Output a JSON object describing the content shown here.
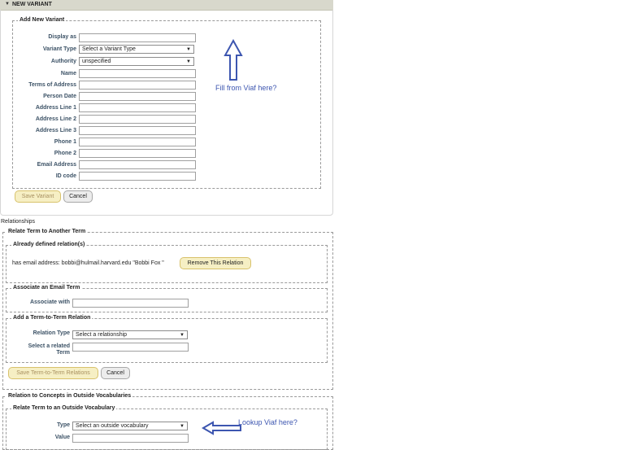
{
  "header": {
    "title": "NEW VARIANT"
  },
  "new_variant": {
    "legend": "Add New Variant",
    "fields": {
      "display_as": {
        "label": "Display as",
        "value": ""
      },
      "variant_type": {
        "label": "Variant Type",
        "selected": "Select a Variant Type"
      },
      "authority": {
        "label": "Authority",
        "selected": "unspecified"
      },
      "name": {
        "label": "Name",
        "value": ""
      },
      "terms_of_address": {
        "label": "Terms of Address",
        "value": ""
      },
      "person_date": {
        "label": "Person Date",
        "value": ""
      },
      "address_line_1": {
        "label": "Address Line 1",
        "value": ""
      },
      "address_line_2": {
        "label": "Address Line 2",
        "value": ""
      },
      "address_line_3": {
        "label": "Address Line 3",
        "value": ""
      },
      "phone_1": {
        "label": "Phone 1",
        "value": ""
      },
      "phone_2": {
        "label": "Phone 2",
        "value": ""
      },
      "email_address": {
        "label": "Email Address",
        "value": ""
      },
      "id_code": {
        "label": "ID code",
        "value": ""
      }
    },
    "save_label": "Save Variant",
    "cancel_label": "Cancel",
    "annotation": "Fill from Viaf here?"
  },
  "relationships": {
    "title": "Relationships",
    "relate_term_legend": "Relate Term to Another Term",
    "already_defined": {
      "legend": "Already defined relation(s)",
      "relation_text": "has email address: bobbi@hulmail.harvard.edu \"Bobbi Fox \"",
      "remove_label": "Remove This Relation"
    },
    "associate_email": {
      "legend": "Associate an Email Term",
      "label": "Associate with",
      "value": ""
    },
    "term_to_term": {
      "legend": "Add a Term-to-Term Relation",
      "relation_type_label": "Relation Type",
      "relation_type_selected": "Select a relationship",
      "related_term_label": "Select a related Term",
      "related_term_value": ""
    },
    "save_label": "Save Term-to-Term Relations",
    "cancel_label": "Cancel"
  },
  "outside": {
    "legend": "Relation to Concepts in Outside Vocabularies",
    "relate_legend": "Relate Term to an Outside Vocabulary",
    "type_label": "Type",
    "type_selected": "Select an outside vocabulary",
    "value_label": "Value",
    "value": "",
    "annotation": "Lookup Viaf here?"
  },
  "colors": {
    "annotation": "#3d56b0",
    "header_bg": "#d8d8cc",
    "button_yellow": "#f6efc4"
  }
}
